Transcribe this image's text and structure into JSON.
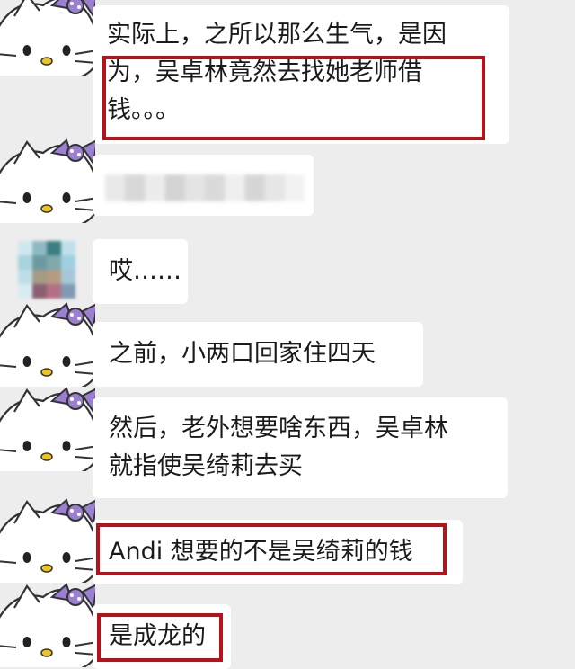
{
  "messages": [
    {
      "sender": "hello-kitty-avatar",
      "text": "实际上，之所以那么生气，是因为，吴卓林竟然去找她老师借钱。。。",
      "lines": [
        "实际上，之所以那么生气，是因",
        "为，吴卓林竟然去找她老师借",
        "钱。。。"
      ]
    },
    {
      "sender": "hello-kitty-avatar",
      "text": ""
    },
    {
      "sender": "pixelated-avatar",
      "text": "哎……"
    },
    {
      "sender": "hello-kitty-avatar",
      "text": "之前，小两口回家住四天"
    },
    {
      "sender": "hello-kitty-avatar",
      "text": "然后，老外想要啥东西，吴卓林就指使吴绮莉去买",
      "lines": [
        "然后，老外想要啥东西，吴卓林",
        "就指使吴绮莉去买"
      ]
    },
    {
      "sender": "hello-kitty-avatar",
      "text": "Andi 想要的不是吴绮莉的钱"
    },
    {
      "sender": "hello-kitty-avatar",
      "text": "是成龙的"
    }
  ],
  "colors": {
    "background": "#ededed",
    "bubble": "#ffffff",
    "highlight": "#b5121b",
    "bow": "#9b7fd0"
  },
  "icons": {
    "avatar": "hello-kitty-icon",
    "bow": "bow-icon"
  }
}
